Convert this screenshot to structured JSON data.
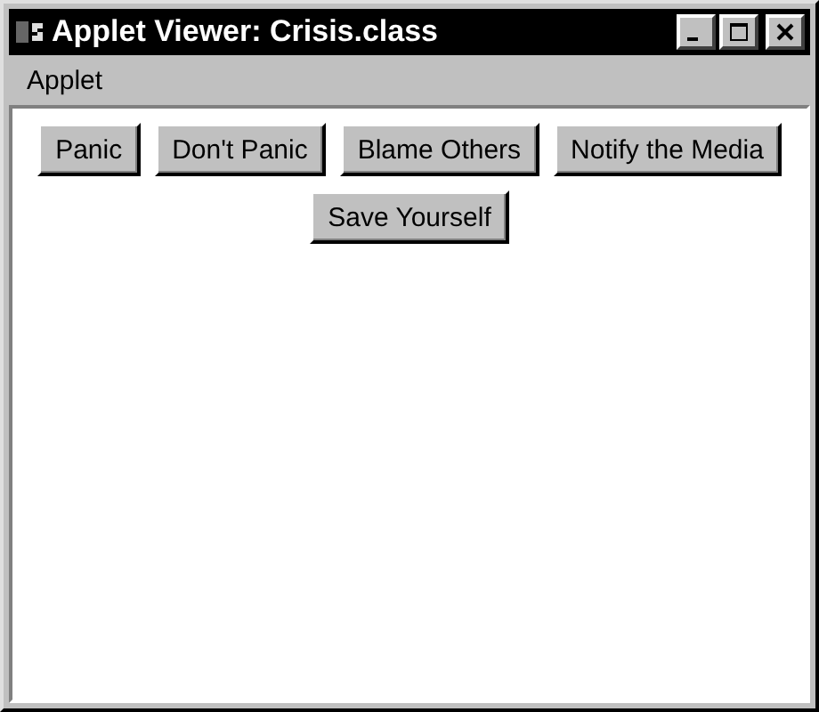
{
  "window": {
    "title": "Applet Viewer: Crisis.class"
  },
  "menu_bar": [
    "Applet"
  ],
  "buttons": [
    "Panic",
    "Don't Panic",
    "Blame Others",
    "Notify the Media",
    "Save Yourself"
  ]
}
